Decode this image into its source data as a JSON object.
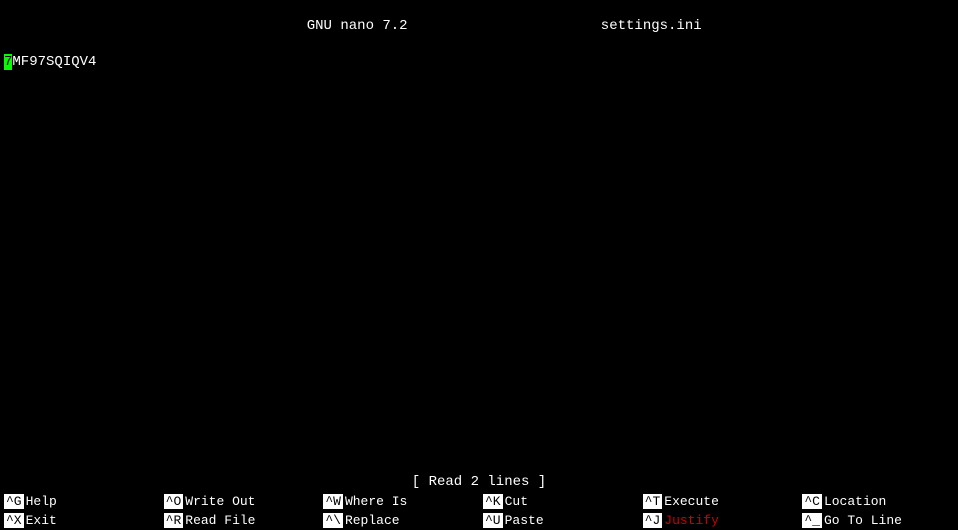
{
  "title_bar": {
    "left": "  GNU nano 7.2",
    "center": "settings.ini",
    "right": ""
  },
  "editor": {
    "lines": [
      {
        "cursor": true,
        "before_cursor": "",
        "cursor_char": "7",
        "after_cursor": "MF97SQIQV4"
      }
    ]
  },
  "status": {
    "message": "[ Read 2 lines ]"
  },
  "shortcuts": [
    {
      "key": "^G",
      "label": "Help",
      "label_class": ""
    },
    {
      "key": "^O",
      "label": "Write Out",
      "label_class": ""
    },
    {
      "key": "^W",
      "label": "Where Is",
      "label_class": ""
    },
    {
      "key": "^K",
      "label": "Cut",
      "label_class": ""
    },
    {
      "key": "^T",
      "label": "Execute",
      "label_class": ""
    },
    {
      "key": "^C",
      "label": "Location",
      "label_class": ""
    },
    {
      "key": "^X",
      "label": "Exit",
      "label_class": ""
    },
    {
      "key": "^R",
      "label": "Read File",
      "label_class": ""
    },
    {
      "key": "^\\",
      "label": "Replace",
      "label_class": ""
    },
    {
      "key": "^U",
      "label": "Paste",
      "label_class": ""
    },
    {
      "key": "^J",
      "label": "Justify",
      "label_class": "red"
    },
    {
      "key": "^_",
      "label": "Go To Line",
      "label_class": ""
    }
  ]
}
